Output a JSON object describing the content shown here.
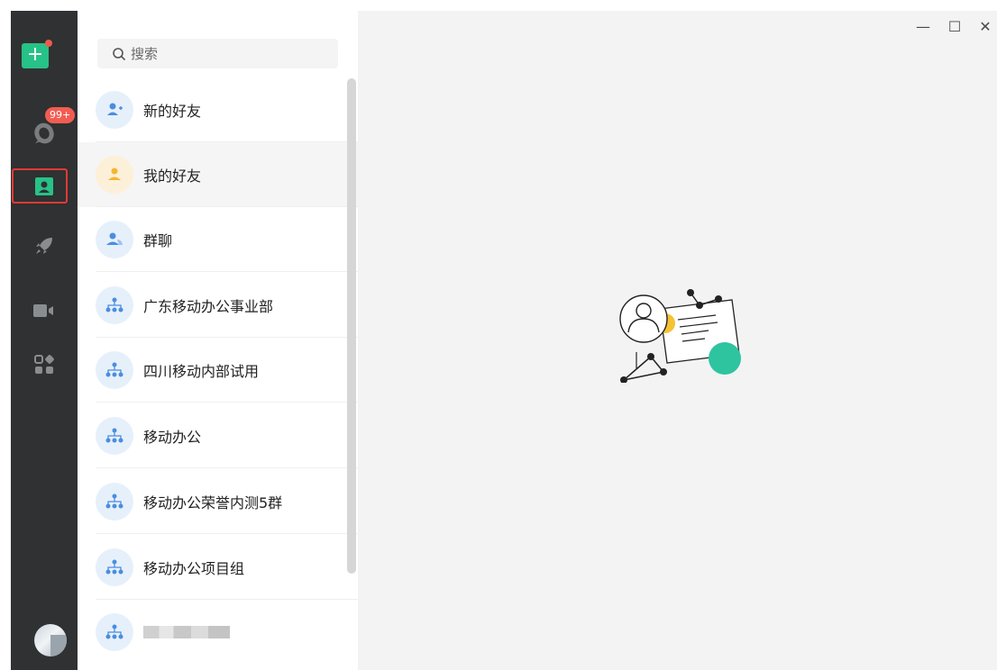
{
  "rail": {
    "new_button": "+",
    "messages_badge": "99+",
    "icons": [
      "plus-icon",
      "chat-icon",
      "contacts-icon",
      "rocket-icon",
      "video-camera-icon",
      "apps-icon"
    ]
  },
  "search": {
    "placeholder": "搜索"
  },
  "contacts": [
    {
      "label": "新的好友",
      "icon": "add-friend-icon"
    },
    {
      "label": "我的好友",
      "icon": "friend-icon",
      "selected": true
    },
    {
      "label": "群聊",
      "icon": "group-chat-icon"
    },
    {
      "label": "广东移动办公事业部",
      "icon": "organization-icon"
    },
    {
      "label": "四川移动内部试用",
      "icon": "organization-icon"
    },
    {
      "label": "移动办公",
      "icon": "organization-icon"
    },
    {
      "label": "移动办公荣誉内测5群",
      "icon": "organization-icon"
    },
    {
      "label": "移动办公项目组",
      "icon": "organization-icon"
    }
  ],
  "window_controls": {
    "minimize": "—",
    "maximize": "☐",
    "close": "✕"
  },
  "colors": {
    "rail_bg": "#2f3132",
    "accent_green": "#27c287",
    "badge_red": "#f25d52",
    "icon_blue": "#4a8de0",
    "friend_orange": "#f5b532",
    "main_bg": "#f3f3f3"
  }
}
